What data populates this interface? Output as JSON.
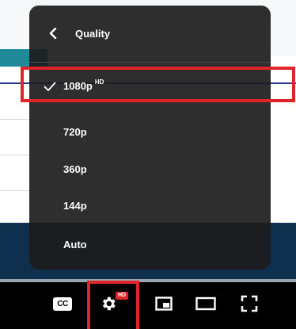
{
  "quality_menu": {
    "title": "Quality",
    "back_icon": "chevron-left-icon",
    "options": [
      {
        "label": "1080p",
        "badge": "HD",
        "selected": true
      },
      {
        "label": "720p",
        "badge": "",
        "selected": false
      },
      {
        "label": "360p",
        "badge": "",
        "selected": false
      },
      {
        "label": "144p",
        "badge": "",
        "selected": false
      },
      {
        "label": "Auto",
        "badge": "",
        "selected": false
      }
    ]
  },
  "controls": {
    "cc_label": "CC",
    "settings_badge": "HD",
    "icons": [
      "subtitles-icon",
      "settings-gear-icon",
      "miniplayer-icon",
      "theater-mode-icon",
      "fullscreen-icon"
    ]
  },
  "colors": {
    "highlight": "#e1242a",
    "menu_bg": "#1c1c1c",
    "control_bg": "#000000"
  }
}
